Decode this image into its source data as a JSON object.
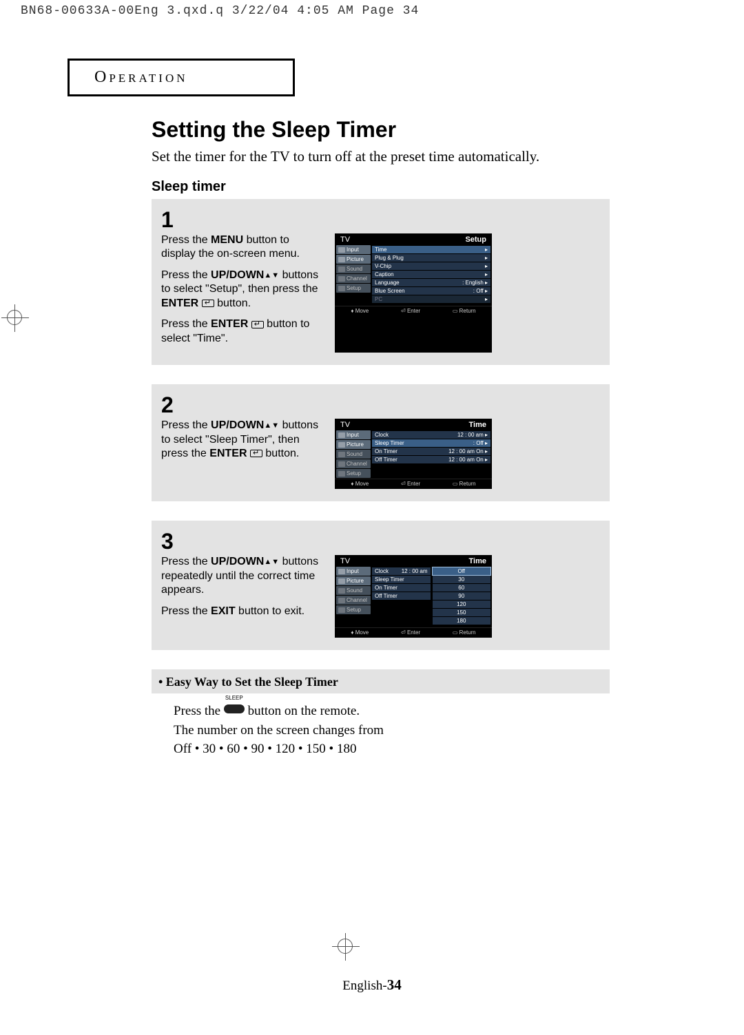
{
  "headerMeta": "BN68-00633A-00Eng 3.qxd.q  3/22/04 4:05 AM  Page 34",
  "sectionTab": "Operation",
  "title": "Setting the Sleep Timer",
  "lede": "Set the timer for the TV to turn off at the preset time automatically.",
  "subhead": "Sleep timer",
  "steps": {
    "s1": {
      "num": "1",
      "p1a": "Press the ",
      "p1b": "MENU",
      "p1c": " button to display the on-screen menu.",
      "p2a": "Press the ",
      "p2b": "UP/DOWN",
      "p2c": " buttons to select \"Setup\", then press the ",
      "p2d": "ENTER",
      "p2e": " button.",
      "p3a": "Press the ",
      "p3b": "ENTER",
      "p3c": " button to select \"Time\"."
    },
    "s2": {
      "num": "2",
      "p1a": "Press the ",
      "p1b": "UP/DOWN",
      "p1c": " buttons to select \"Sleep Timer\", then press the ",
      "p1d": "ENTER",
      "p1e": " button."
    },
    "s3": {
      "num": "3",
      "p1a": "Press the ",
      "p1b": "UP/DOWN",
      "p1c": " buttons repeatedly until the correct time appears.",
      "p2a": "Press the ",
      "p2b": "EXIT",
      "p2c": " button to exit."
    }
  },
  "tv": {
    "sideTabs": [
      "Input",
      "Picture",
      "Sound",
      "Channel",
      "Setup"
    ],
    "foot": {
      "move": "Move",
      "enter": "Enter",
      "return": "Return"
    },
    "screen1": {
      "topL": "TV",
      "topR": "Setup",
      "rows": [
        {
          "l": "Time",
          "r": "",
          "hi": true
        },
        {
          "l": "Plug & Plug",
          "r": ""
        },
        {
          "l": "V-Chip",
          "r": ""
        },
        {
          "l": "Caption",
          "r": ""
        },
        {
          "l": "Language",
          "r": ": English"
        },
        {
          "l": "Blue Screen",
          "r": ": Off"
        },
        {
          "l": "PC",
          "r": "",
          "faded": true
        }
      ]
    },
    "screen2": {
      "topL": "TV",
      "topR": "Time",
      "rows": [
        {
          "l": "Clock",
          "r": "12 : 00   am"
        },
        {
          "l": "Sleep Timer",
          "r": ": Off",
          "hi": true
        },
        {
          "l": "On Timer",
          "r": "12 : 00   am On"
        },
        {
          "l": "Off Timer",
          "r": "12 : 00   am On"
        }
      ]
    },
    "screen3": {
      "topL": "TV",
      "topR": "Time",
      "rowsLeft": [
        {
          "l": "Clock",
          "r": "12 : 00   am"
        },
        {
          "l": "Sleep Timer",
          "r": ""
        },
        {
          "l": "On Timer",
          "r": ""
        },
        {
          "l": "Off Timer",
          "r": ""
        }
      ],
      "options": [
        "Off",
        "30",
        "60",
        "90",
        "120",
        "150",
        "180"
      ]
    }
  },
  "easy": {
    "heading": "• Easy Way to Set the Sleep Timer",
    "line1a": "Press the ",
    "sleepLabel": "SLEEP",
    "line1b": " button on the remote.",
    "line2": "The number on the screen changes from",
    "line3": "Off • 30 • 60 • 90 • 120 • 150 • 180"
  },
  "pageNo": {
    "prefix": "English-",
    "num": "34"
  }
}
